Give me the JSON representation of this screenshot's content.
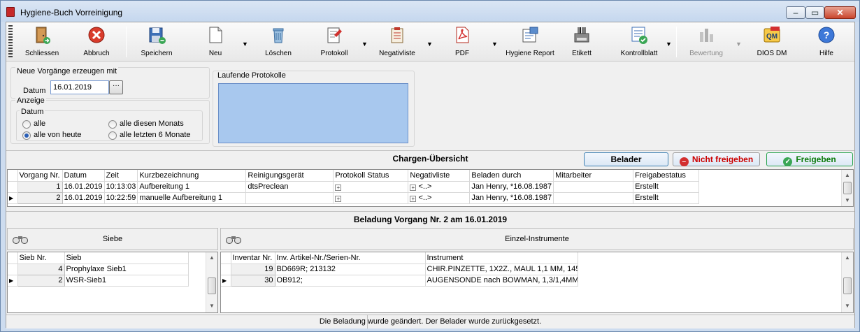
{
  "window": {
    "title": "Hygiene-Buch Vorreinigung"
  },
  "toolbar": {
    "buttons": [
      {
        "label": "Schliessen",
        "icon": "door-exit-icon"
      },
      {
        "label": "Abbruch",
        "icon": "cancel-icon"
      },
      {
        "label": "Speichern",
        "icon": "save-icon"
      },
      {
        "label": "Neu",
        "icon": "new-document-icon"
      },
      {
        "label": "Löschen",
        "icon": "trash-icon"
      },
      {
        "label": "Protokoll",
        "icon": "protocol-icon"
      },
      {
        "label": "Negativliste",
        "icon": "clipboard-list-icon"
      },
      {
        "label": "PDF",
        "icon": "pdf-icon"
      },
      {
        "label": "Hygiene Report",
        "icon": "report-icon"
      },
      {
        "label": "Etikett",
        "icon": "barcode-printer-icon"
      },
      {
        "label": "Kontrollblatt",
        "icon": "checklist-icon"
      },
      {
        "label": "Bewertung",
        "icon": "evaluation-icon",
        "disabled": true
      },
      {
        "label": "DIOS DM",
        "icon": "dios-dm-icon"
      },
      {
        "label": "Hilfe",
        "icon": "help-icon"
      }
    ]
  },
  "new_processes": {
    "legend": "Neue Vorgänge erzeugen mit",
    "date_label": "Datum",
    "date_value": "16.01.2019",
    "date_picker_label": "···"
  },
  "display": {
    "legend": "Anzeige",
    "date_legend": "Datum",
    "options": [
      "alle",
      "alle von heute",
      "alle diesen Monats",
      "alle letzten 6 Monate"
    ],
    "selected": "alle von heute"
  },
  "running_protocols": {
    "legend": "Laufende Protokolle"
  },
  "batch_overview": {
    "title": "Chargen-Übersicht",
    "buttons": {
      "loader": "Belader",
      "reject": "Nicht freigeben",
      "approve": "Freigeben"
    },
    "columns": [
      "Vorgang Nr.",
      "Datum",
      "Zeit",
      "Kurzbezeichnung",
      "Reinigungsgerät",
      "Protokoll Status",
      "Negativliste",
      "Beladen durch",
      "Mitarbeiter",
      "Freigabestatus"
    ],
    "rows": [
      {
        "nr": "1",
        "date": "16.01.2019",
        "time": "10:13:03",
        "short": "Aufbereitung 1",
        "device": "dtsPreclean",
        "protocol": "",
        "negative": "<..>",
        "loaded_by": "Jan Henry, *16.08.1987",
        "employee": "",
        "status": "Erstellt"
      },
      {
        "nr": "2",
        "date": "16.01.2019",
        "time": "10:22:59",
        "short": "manuelle Aufbereitung 1",
        "device": "",
        "protocol": "",
        "negative": "<..>",
        "loaded_by": "Jan Henry, *16.08.1987",
        "employee": "",
        "status": "Erstellt"
      }
    ]
  },
  "loading": {
    "title": "Beladung Vorgang Nr. 2 am 16.01.2019",
    "sieves": {
      "header": "Siebe",
      "columns": [
        "Sieb Nr.",
        "Sieb"
      ],
      "rows": [
        {
          "nr": "4",
          "name": "Prophylaxe Sieb1"
        },
        {
          "nr": "2",
          "name": "WSR-Sieb1"
        }
      ]
    },
    "instruments": {
      "header": "Einzel-Instrumente",
      "columns": [
        "Inventar Nr.",
        "Inv. Artikel-Nr./Serien-Nr.",
        "Instrument"
      ],
      "rows": [
        {
          "nr": "19",
          "article": "BD669R; 213132",
          "instrument": "CHIR.PINZETTE, 1X2Z., MAUL 1,1 MM, 145"
        },
        {
          "nr": "30",
          "article": "OB912;",
          "instrument": "AUGENSONDE nach BOWMAN, 1,3/1,4MM"
        }
      ]
    }
  },
  "status": {
    "message": "Die Beladung wurde geändert. Der Belader wurde zurückgesetzt."
  }
}
